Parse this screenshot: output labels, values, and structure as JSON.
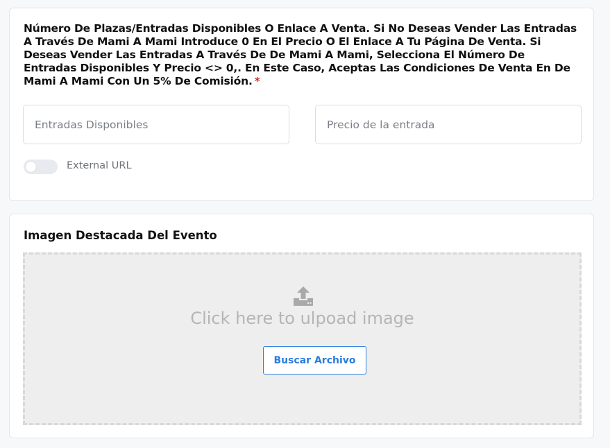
{
  "tickets": {
    "label": "Número De Plazas/Entradas Disponibles O Enlace A Venta. Si No Deseas Vender Las Entradas A Través De Mami A Mami Introduce 0 En El Precio O El Enlace A Tu Página De Venta. Si Deseas Vender Las Entradas A Través De De Mami A Mami, Selecciona El Número De Entradas Disponibles Y Precio <> 0,. En Este Caso, Aceptas Las Condiciones De Venta En De Mami A Mami Con Un 5% De Comisión.",
    "required_mark": "*",
    "available_placeholder": "Entradas Disponibles",
    "available_value": "",
    "price_placeholder": "Precio de la entrada",
    "price_value": "",
    "external_url_label": "External URL",
    "external_url_enabled": false
  },
  "featured_image": {
    "title": "Imagen Destacada Del Evento",
    "upload_icon": "upload-icon",
    "dropzone_text": "Click here to ulpoad image",
    "browse_label": "Buscar Archivo"
  },
  "colors": {
    "accent": "#2a7ddf",
    "required": "#e02424",
    "dropzone_bg": "#eeeeee"
  }
}
